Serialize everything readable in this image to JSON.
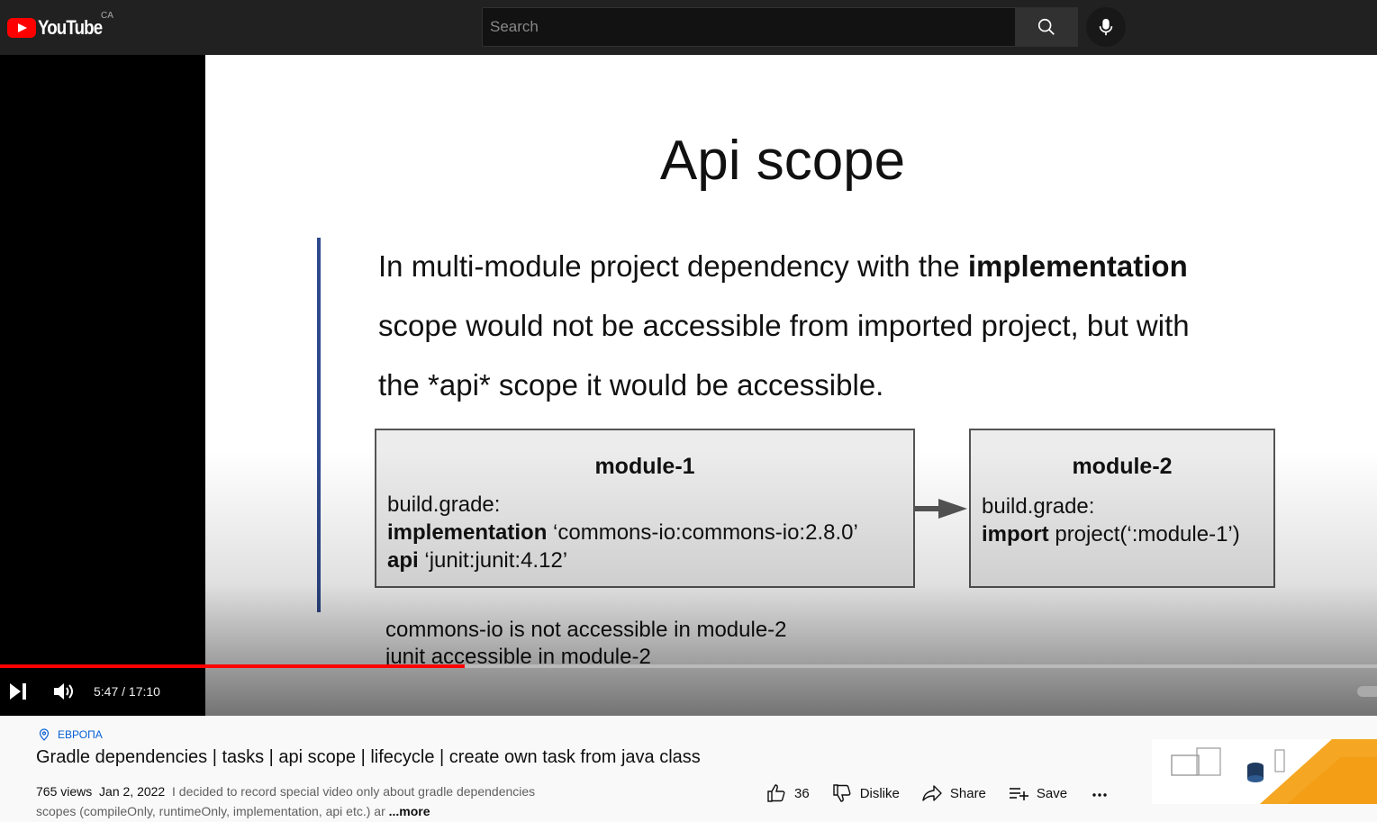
{
  "header": {
    "logo_text": "YouTube",
    "country_code": "CA",
    "search_placeholder": "Search"
  },
  "player": {
    "slide": {
      "title": "Api scope",
      "body_line1_plain": "In multi-module project dependency with the ",
      "body_line1_bold": "implementation",
      "body_line2": "scope would not be accessible from imported project, but with",
      "body_line3": "the *api* scope it would be accessible.",
      "module1": {
        "title": "module-1",
        "line1": "build.grade:",
        "line2_bold": "implementation",
        "line2_rest": " ‘commons-io:commons-io:2.8.0’",
        "line3_bold": "api",
        "line3_rest": " ‘junit:junit:4.12’"
      },
      "module2": {
        "title": "module-2",
        "line1": "build.grade:",
        "line2_bold": "import",
        "line2_rest": " project(‘:module-1’)"
      },
      "note1": "commons-io is not accessible in module-2",
      "note2": "junit accessible in module-2"
    },
    "time_display": "5:47 / 17:10",
    "progress_fraction": 0.3373,
    "accent_color": "#ff0000"
  },
  "video": {
    "location": "ЕВРОПА",
    "title": "Gradle dependencies | tasks | api scope | lifecycle | create own task from java class",
    "views": "765 views",
    "date": "Jan 2, 2022",
    "description": "I decided to record special video only about gradle dependencies scopes (compileOnly, runtimeOnly, implementation, api etc.) ar",
    "more_label": "...more",
    "like_count": "36",
    "dislike_label": "Dislike",
    "share_label": "Share",
    "save_label": "Save"
  }
}
